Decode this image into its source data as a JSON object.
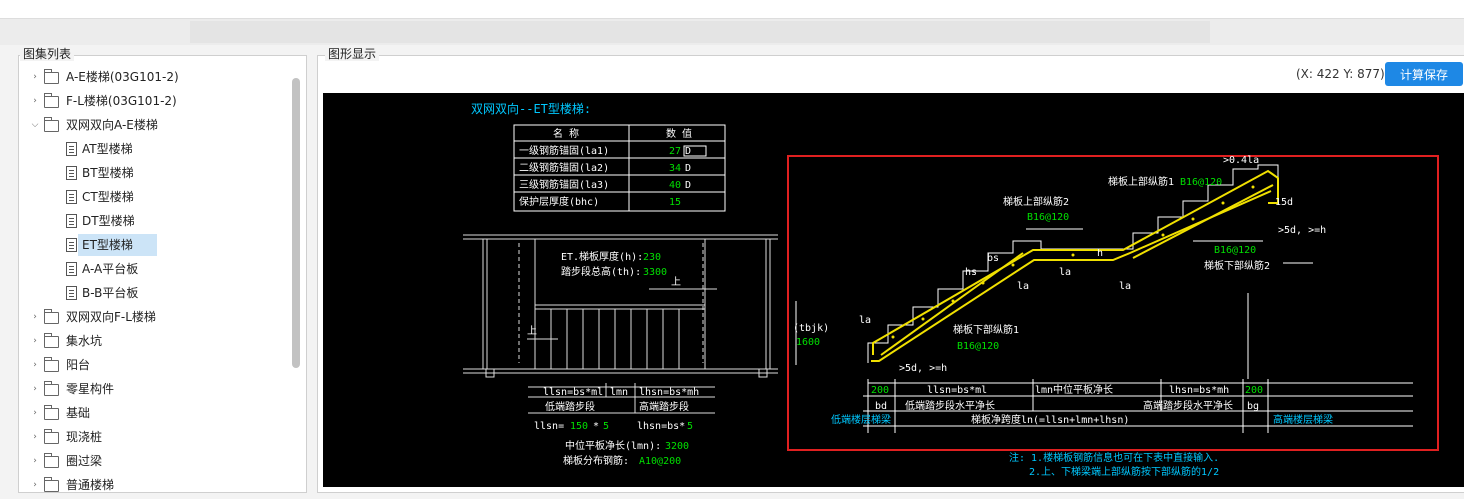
{
  "left_panel": {
    "title": "图集列表",
    "tree": [
      {
        "label": "A-E楼梯(03G101-2)",
        "kind": "folder"
      },
      {
        "label": "F-L楼梯(03G101-2)",
        "kind": "folder"
      },
      {
        "label": "双网双向A-E楼梯",
        "kind": "folder-open"
      },
      {
        "label": "AT型楼梯",
        "kind": "doc"
      },
      {
        "label": "BT型楼梯",
        "kind": "doc"
      },
      {
        "label": "CT型楼梯",
        "kind": "doc"
      },
      {
        "label": "DT型楼梯",
        "kind": "doc"
      },
      {
        "label": "ET型楼梯",
        "kind": "doc",
        "selected": true
      },
      {
        "label": "A-A平台板",
        "kind": "doc"
      },
      {
        "label": "B-B平台板",
        "kind": "doc"
      },
      {
        "label": "双网双向F-L楼梯",
        "kind": "folder"
      },
      {
        "label": "集水坑",
        "kind": "folder"
      },
      {
        "label": "阳台",
        "kind": "folder"
      },
      {
        "label": "零星构件",
        "kind": "folder"
      },
      {
        "label": "基础",
        "kind": "folder"
      },
      {
        "label": "现浇桩",
        "kind": "folder"
      },
      {
        "label": "圈过梁",
        "kind": "folder"
      },
      {
        "label": "普通楼梯",
        "kind": "folder"
      }
    ]
  },
  "right_panel": {
    "title": "图形显示",
    "coords": "(X: 422 Y: 877)",
    "calc_button": "计算保存"
  },
  "drawing": {
    "title": "双网双向--ET型楼梯:",
    "table_headers": [
      "名 称",
      "数 值"
    ],
    "table_rows": [
      {
        "name": "一级钢筋锚固(la1)",
        "value": "27",
        "unit": "D"
      },
      {
        "name": "二级钢筋锚固(la2)",
        "value": "34",
        "unit": "D"
      },
      {
        "name": "三级钢筋锚固(la3)",
        "value": "40",
        "unit": "D"
      },
      {
        "name": "保护层厚度(bhc)",
        "value": "15",
        "unit": ""
      }
    ],
    "plan_thickness_label": "ET.梯板厚度(h):",
    "plan_thickness_value": "230",
    "plan_height_label": "踏步段总高(th):",
    "plan_height_value": "3300",
    "plan_up": "上",
    "plan_dim1": "llsn=bs*ml",
    "plan_dim2": "lmn",
    "plan_dim3": "lhsn=bs*mh",
    "plan_low": "低端踏步段",
    "plan_high": "高端踏步段",
    "llsn_label": "llsn=",
    "llsn_value": "150",
    "llsn_mult": "*",
    "llsn_count": "5",
    "lhsn_label": "lhsn=bs*",
    "lhsn_count": "5",
    "mid_label": "中位平板净长(lmn):",
    "mid_value": "3200",
    "dist_label": "梯板分布钢筋:",
    "dist_value": "A10@200",
    "sec_top_label": "梯板上部纵筋1",
    "sec_top_value": "B16@120",
    "sec_top2_label": "梯板上部纵筋2",
    "sec_top2_value": "B16@120",
    "sec_bot1_label": "梯板下部纵筋1",
    "sec_bot1_value": "B16@120",
    "sec_bot2_label": "梯板下部纵筋2",
    "sec_bot2_value": "B16@120",
    "sec_041": ">0.4la",
    "sec_15d": "15d",
    "sec_5d_right": ">5d, >=h",
    "sec_5d_left": ">5d, >=h",
    "sec_bs": "bs",
    "sec_hs": "hs",
    "sec_h": "h",
    "sec_la": "la",
    "sec_tbjk": "(tbjk)",
    "sec_tbjk_value": "1600",
    "sec_bd_value": "200",
    "sec_bg_value": "200",
    "sec_bd": "bd",
    "sec_bg": "bg",
    "sec_dim_llsn": "llsn=bs*ml",
    "sec_dim_lmn": "lmn中位平板净长",
    "sec_dim_lhsn": "lhsn=bs*mh",
    "sec_low_flat": "低端踏步段水平净长",
    "sec_high_flat": "高端踏步段水平净长",
    "sec_total": "梯板净跨度ln(=llsn+lmn+lhsn)",
    "sec_low_beam": "低端楼层梯梁",
    "sec_high_beam": "高端楼层梯梁",
    "note1": "注: 1.楼梯板钢筋信息也可在下表中直接输入.",
    "note2": "2.上、下梯梁端上部纵筋按下部纵筋的1/2"
  },
  "colors": {
    "accent": "#1e88e5",
    "cad_green": "#00e000",
    "cad_cyan": "#00c8ff",
    "cad_yellow": "#f0e000",
    "highlight_red": "#e02020"
  }
}
